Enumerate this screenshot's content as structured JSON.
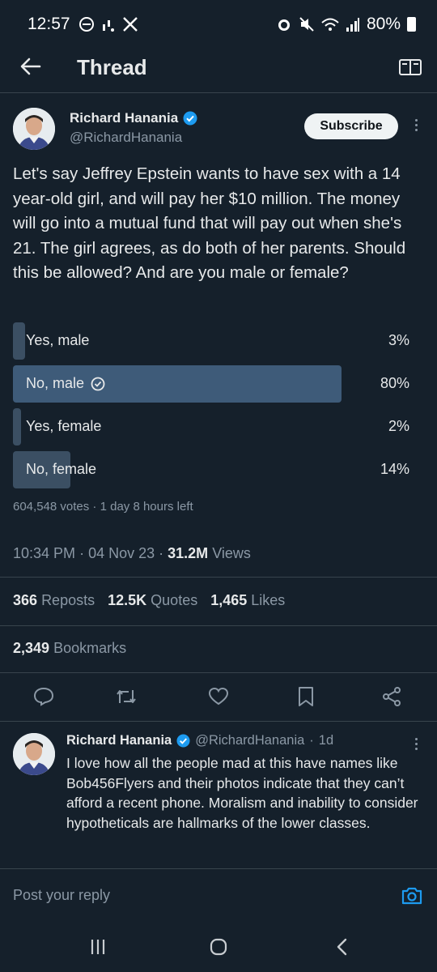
{
  "status_bar": {
    "time": "12:57",
    "battery": "80%"
  },
  "header": {
    "title": "Thread"
  },
  "tweet": {
    "author_name": "Richard Hanania",
    "handle": "@RichardHanania",
    "subscribe_label": "Subscribe",
    "text": "Let's say Jeffrey Epstein wants to have sex with a 14 year-old girl, and will pay her $10 million. The money will go into a mutual fund that will pay out when she's 21. The girl agrees, as do both of her parents. Should this be allowed? And are you male or female?",
    "poll": {
      "options": [
        {
          "label": "Yes, male",
          "percent": "3%",
          "fraction": 0.03,
          "winner": false
        },
        {
          "label": "No, male",
          "percent": "80%",
          "fraction": 0.8,
          "winner": true
        },
        {
          "label": "Yes, female",
          "percent": "2%",
          "fraction": 0.02,
          "winner": false
        },
        {
          "label": "No, female",
          "percent": "14%",
          "fraction": 0.14,
          "winner": false
        }
      ],
      "votes": "604,548 votes",
      "time_left": "1 day 8 hours left"
    },
    "time": "10:34 PM",
    "date": "04 Nov 23",
    "views_count": "31.2M",
    "views_label": "Views",
    "reposts_count": "366",
    "reposts_label": "Reposts",
    "quotes_count": "12.5K",
    "quotes_label": "Quotes",
    "likes_count": "1,465",
    "likes_label": "Likes",
    "bookmarks_count": "2,349",
    "bookmarks_label": "Bookmarks"
  },
  "reply": {
    "author_name": "Richard Hanania",
    "handle": "@RichardHanania",
    "age": "1d",
    "text": "I love how all the people mad at this have names like Bob456Flyers and their photos indicate that they can’t afford a recent phone. Moralism and inability to consider hypotheticals are hallmarks of the lower classes."
  },
  "composer": {
    "placeholder": "Post your reply"
  },
  "colors": {
    "background": "#15202b",
    "accent": "#1d9bf0",
    "poll_bar": "#3b4f63",
    "poll_bar_winner": "#3e5b79"
  }
}
